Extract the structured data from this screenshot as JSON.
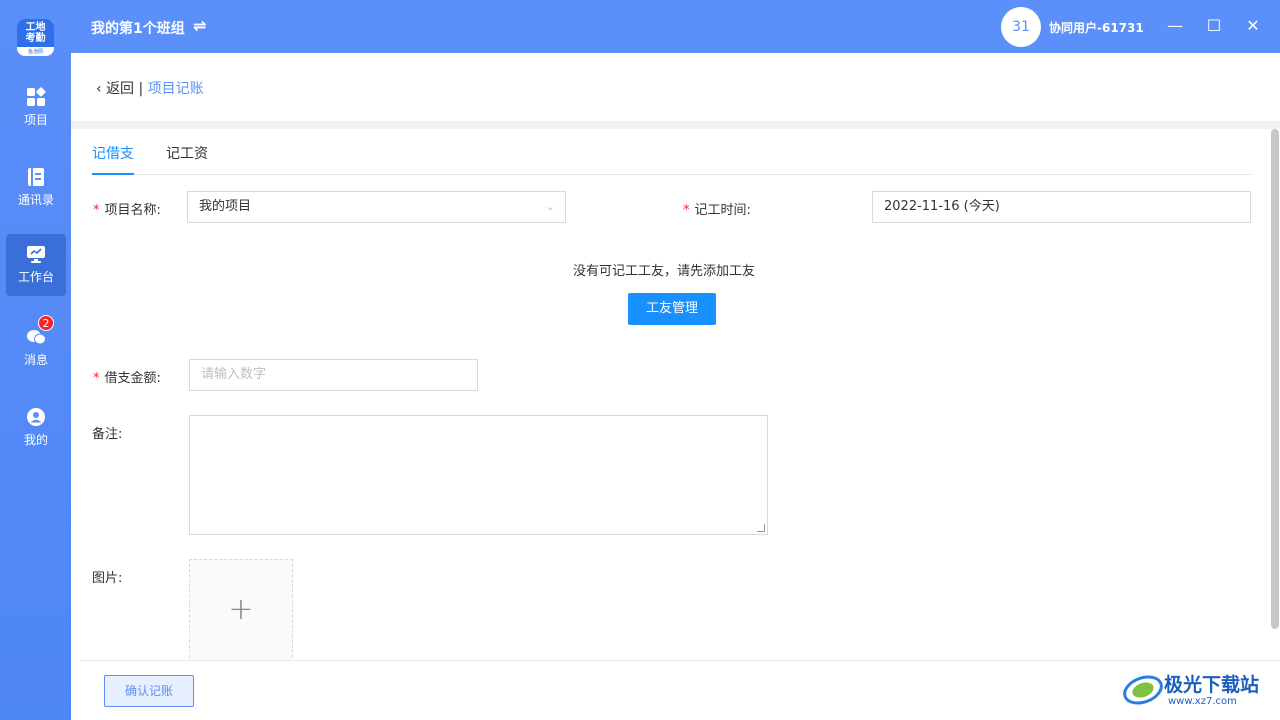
{
  "sidebar": {
    "logo_top": "工地\n考勤",
    "logo_bottom": "鱼泡网",
    "items": [
      {
        "label": "项目",
        "icon": "grid-icon"
      },
      {
        "label": "通讯录",
        "icon": "contacts-icon"
      },
      {
        "label": "工作台",
        "icon": "workbench-icon",
        "active": true
      },
      {
        "label": "消息",
        "icon": "chat-icon",
        "badge": "2"
      },
      {
        "label": "我的",
        "icon": "user-icon"
      }
    ]
  },
  "titlebar": {
    "team_name": "我的第1个班组",
    "swap_icon": "⇌",
    "avatar_text": "31",
    "username": "协同用户-61731",
    "minimize": "—",
    "maximize": "☐",
    "close": "✕"
  },
  "breadcrumb": {
    "back": "返回",
    "separator": "|",
    "current": "项目记账"
  },
  "tabs": [
    {
      "label": "记借支",
      "active": true
    },
    {
      "label": "记工资",
      "active": false
    }
  ],
  "form": {
    "project_label": "项目名称:",
    "project_value": "我的项目",
    "date_label": "记工时间:",
    "date_value": "2022-11-16 (今天)",
    "notice": "没有可记工工友，请先添加工友",
    "manage_button": "工友管理",
    "amount_label": "借支金额:",
    "amount_placeholder": "请输入数字",
    "remark_label": "备注:",
    "image_label": "图片:",
    "upload_plus": "+"
  },
  "footer": {
    "confirm_button": "确认记账"
  },
  "watermark": {
    "text": "极光下载站",
    "url": "www.xz7.com"
  },
  "colors": {
    "brand": "#5b8ff9",
    "primary": "#1890ff",
    "required": "#f5222d"
  }
}
